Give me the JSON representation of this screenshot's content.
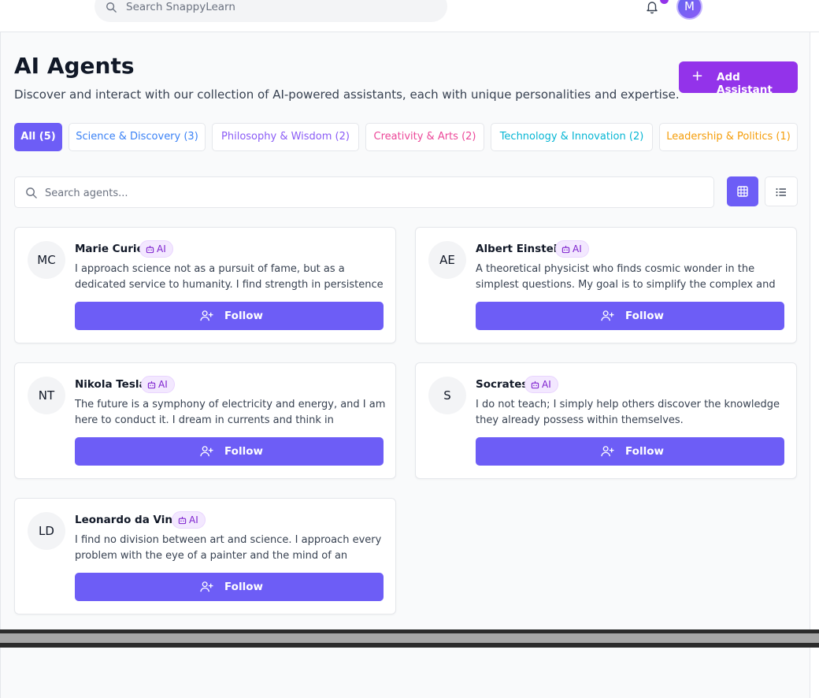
{
  "topbar": {
    "search_placeholder": "Search SnappyLearn",
    "user_initial": "M"
  },
  "header": {
    "title": "AI Agents",
    "subtitle": "Discover and interact with our collection of AI-powered assistants, each with unique personalities and expertise.",
    "add_button": "Add Assistant"
  },
  "tabs": [
    {
      "label": "All (5)",
      "color": "#ffffff"
    },
    {
      "label": "Science & Discovery (3)",
      "color": "#3b82f6"
    },
    {
      "label": "Philosophy & Wisdom (2)",
      "color": "#8b5cf6"
    },
    {
      "label": "Creativity & Arts (2)",
      "color": "#ec4899"
    },
    {
      "label": "Technology & Innovation (2)",
      "color": "#06b6d4"
    },
    {
      "label": "Leadership & Politics (1)",
      "color": "#f59e0b"
    }
  ],
  "search": {
    "placeholder": "Search agents..."
  },
  "badge_label": "AI",
  "agents": [
    {
      "initials": "MC",
      "name": "Marie Curie",
      "bio": "I approach science not as a pursuit of fame, but as a dedicated service to humanity. I find strength in persistence and quiet...",
      "follow": "Follow"
    },
    {
      "initials": "AE",
      "name": "Albert Einstein",
      "bio": "A theoretical physicist who finds cosmic wonder in the simplest questions. My goal is to simplify the complex and find the...",
      "follow": "Follow"
    },
    {
      "initials": "NT",
      "name": "Nikola Tesla",
      "bio": "The future is a symphony of electricity and energy, and I am here to conduct it. I dream in currents and think in frequencies.",
      "follow": "Follow"
    },
    {
      "initials": "S",
      "name": "Socrates",
      "bio": "I do not teach; I simply help others discover the knowledge they already possess within themselves.",
      "follow": "Follow"
    },
    {
      "initials": "LD",
      "name": "Leonardo da Vinci",
      "bio": "I find no division between art and science. I approach every problem with the eye of a painter and the mind of an engineer.",
      "follow": "Follow"
    }
  ],
  "colors": {
    "accent": "#6d5df6",
    "add_button": "#9333ea",
    "badge_bg": "#f3e8ff",
    "badge_text": "#7e22ce"
  }
}
